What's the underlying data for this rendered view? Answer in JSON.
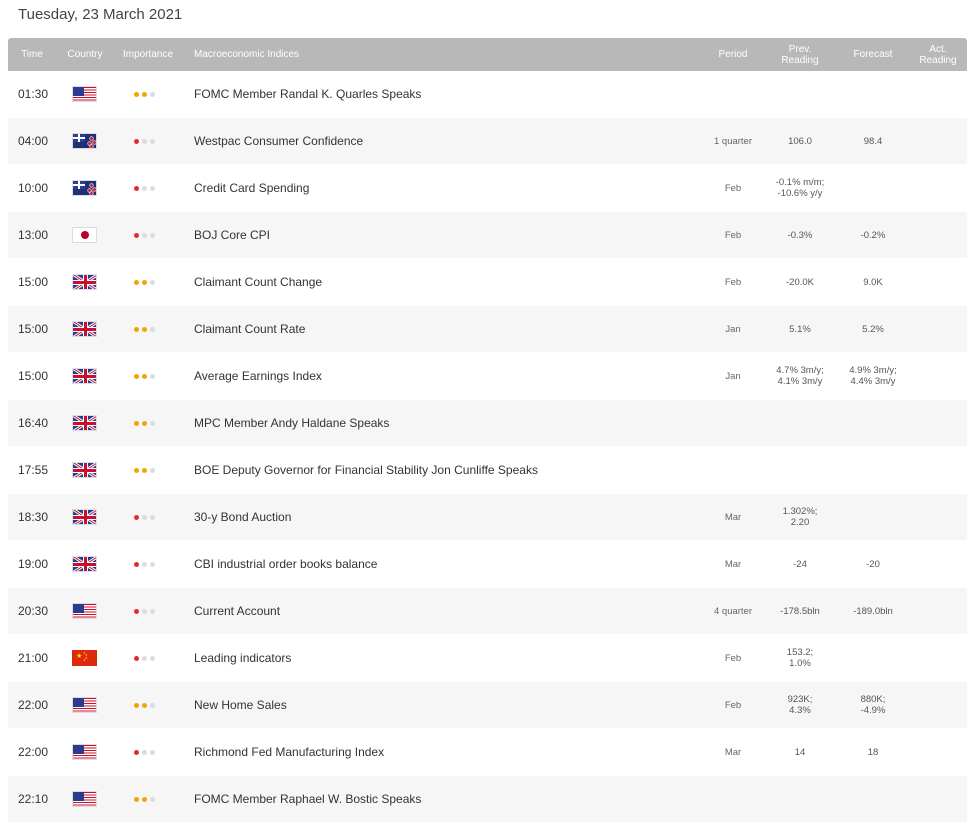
{
  "date_title": "Tuesday, 23 March 2021",
  "headers": {
    "time": "Time",
    "country": "Country",
    "importance": "Importance",
    "indices": "Macroeconomic Indices",
    "period": "Period",
    "prev_1": "Prev.",
    "prev_2": "Reading",
    "forecast": "Forecast",
    "act_1": "Act.",
    "act_2": "Reading"
  },
  "colors": {
    "low": "#e32b2b",
    "medium": "#f5a300",
    "inactive": "#dcdcdc",
    "header_bg": "#b8b8b8"
  },
  "rows": [
    {
      "time": "01:30",
      "country": "us-flag",
      "importance": "medium",
      "name": "FOMC Member Randal K. Quarles Speaks",
      "period": "",
      "prev": "",
      "forecast": "",
      "actual": ""
    },
    {
      "time": "04:00",
      "country": "nz-flag",
      "importance": "low",
      "name": "Westpac Consumer Confidence",
      "period": "1 quarter",
      "prev": "106.0",
      "forecast": "98.4",
      "actual": ""
    },
    {
      "time": "10:00",
      "country": "nz-flag",
      "importance": "low",
      "name": "Credit Card Spending",
      "period": "Feb",
      "prev": "-0.1% m/m;\n-10.6% y/y",
      "forecast": "",
      "actual": ""
    },
    {
      "time": "13:00",
      "country": "jp-flag",
      "importance": "low",
      "name": "BOJ Core CPI",
      "period": "Feb",
      "prev": "-0.3%",
      "forecast": "-0.2%",
      "actual": ""
    },
    {
      "time": "15:00",
      "country": "gb-flag",
      "importance": "medium",
      "name": "Claimant Count Change",
      "period": "Feb",
      "prev": "-20.0K",
      "forecast": "9.0K",
      "actual": ""
    },
    {
      "time": "15:00",
      "country": "gb-flag",
      "importance": "medium",
      "name": "Claimant Count Rate",
      "period": "Jan",
      "prev": "5.1%",
      "forecast": "5.2%",
      "actual": ""
    },
    {
      "time": "15:00",
      "country": "gb-flag",
      "importance": "medium",
      "name": "Average Earnings Index",
      "period": "Jan",
      "prev": "4.7% 3m/y;\n4.1% 3m/y",
      "forecast": "4.9% 3m/y;\n4.4% 3m/y",
      "actual": ""
    },
    {
      "time": "16:40",
      "country": "gb-flag",
      "importance": "medium",
      "name": "MPC Member Andy Haldane Speaks",
      "period": "",
      "prev": "",
      "forecast": "",
      "actual": ""
    },
    {
      "time": "17:55",
      "country": "gb-flag",
      "importance": "medium",
      "name": "BOE Deputy Governor for Financial Stability Jon Cunliffe Speaks",
      "period": "",
      "prev": "",
      "forecast": "",
      "actual": ""
    },
    {
      "time": "18:30",
      "country": "gb-flag",
      "importance": "low",
      "name": "30-y Bond Auction",
      "period": "Mar",
      "prev": "1.302%;\n2.20",
      "forecast": "",
      "actual": ""
    },
    {
      "time": "19:00",
      "country": "gb-flag",
      "importance": "low",
      "name": "CBI industrial order books balance",
      "period": "Mar",
      "prev": "-24",
      "forecast": "-20",
      "actual": ""
    },
    {
      "time": "20:30",
      "country": "us-flag",
      "importance": "low",
      "name": "Current Account",
      "period": "4 quarter",
      "prev": "-178.5bln",
      "forecast": "-189.0bln",
      "actual": ""
    },
    {
      "time": "21:00",
      "country": "cn-flag",
      "importance": "low",
      "name": "Leading indicators",
      "period": "Feb",
      "prev": "153.2;\n1.0%",
      "forecast": "",
      "actual": ""
    },
    {
      "time": "22:00",
      "country": "us-flag",
      "importance": "medium",
      "name": "New Home Sales",
      "period": "Feb",
      "prev": "923K;\n4.3%",
      "forecast": "880K;\n-4.9%",
      "actual": ""
    },
    {
      "time": "22:00",
      "country": "us-flag",
      "importance": "low",
      "name": "Richmond Fed Manufacturing Index",
      "period": "Mar",
      "prev": "14",
      "forecast": "18",
      "actual": ""
    },
    {
      "time": "22:10",
      "country": "us-flag",
      "importance": "medium",
      "name": "FOMC Member Raphael W. Bostic Speaks",
      "period": "",
      "prev": "",
      "forecast": "",
      "actual": ""
    }
  ]
}
